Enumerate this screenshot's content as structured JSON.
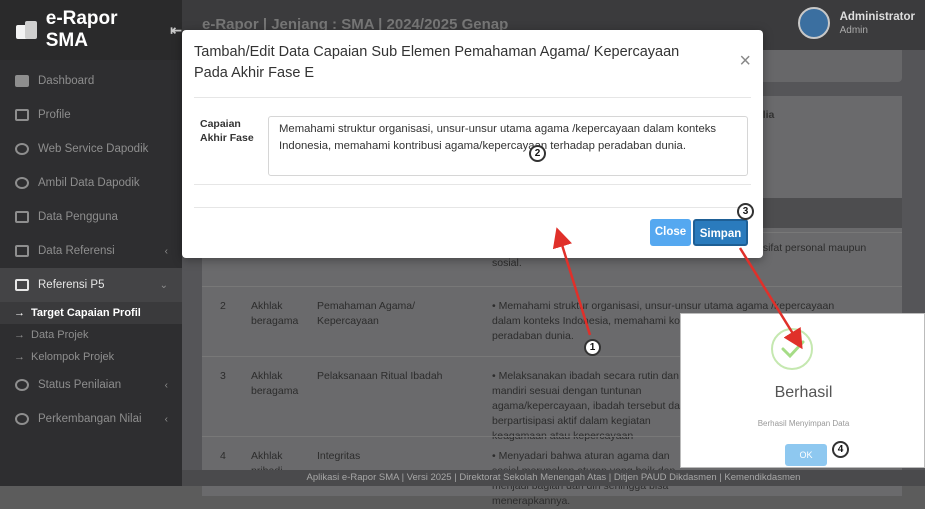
{
  "app": {
    "brand": "e-Rapor SMA",
    "collapse_icon": "collapse-left-icon"
  },
  "sidebar": {
    "items": [
      {
        "label": "Dashboard",
        "icon": "dashboard-icon"
      },
      {
        "label": "Profile",
        "icon": "profile-icon"
      },
      {
        "label": "Web Service Dapodik",
        "icon": "gear-icon"
      },
      {
        "label": "Ambil Data Dapodik",
        "icon": "database-icon"
      },
      {
        "label": "Data Pengguna",
        "icon": "users-icon"
      },
      {
        "label": "Data Referensi",
        "icon": "monitor-icon"
      },
      {
        "label": "Referensi P5",
        "icon": "list-icon"
      },
      {
        "label": "Target Capaian Profil",
        "icon": "arrow-icon"
      },
      {
        "label": "Data Projek",
        "icon": "arrow-icon"
      },
      {
        "label": "Kelompok Projek",
        "icon": "arrow-icon"
      },
      {
        "label": "Status Penilaian",
        "icon": "grad-cap-icon"
      },
      {
        "label": "Perkembangan Nilai",
        "icon": "grad-cap-icon"
      }
    ]
  },
  "topbar": {
    "title": "e-Rapor | Jenjang : SMA | 2024/2025 Genap",
    "user_name": "Administrator",
    "user_role": "Admin"
  },
  "content": {
    "tab_title": "erakhlak Mulia",
    "rows": [
      {
        "no": "2",
        "dimensi": "Akhlak beragama",
        "sub": "Pemahaman Agama/ Kepercayaan",
        "desc": "• Memahami struktur organisasi, unsur-unsur utama agama /kepercayaan dalam konteks Indonesia, memahami kontribusi agama/kepercayaan terhadap peradaban dunia."
      },
      {
        "no": "3",
        "dimensi": "Akhlak beragama",
        "sub": "Pelaksanaan Ritual Ibadah",
        "desc": "• Melaksanakan ibadah secara rutin dan mandiri sesuai dengan tuntunan agama/kepercayaan, ibadah tersebut dan berpartisipasi aktif dalam kegiatan keagamaan atau kepercayaan"
      },
      {
        "no": "4",
        "dimensi": "Akhlak pribadi",
        "sub": "Integritas",
        "desc": "• Menyadari bahwa aturan agama dan sosial merupakan aturan yang baik dan menjadi bagian dari diri sehingga bisa menerapkannya."
      }
    ],
    "row1_tail": "at-sifat Tuhan dalam ritual ibadahnya dan ibadah yang bersifat personal maupun sosial."
  },
  "footer": "Aplikasi e-Rapor SMA | Versi 2025 | Direktorat Sekolah Menengah Atas | Ditjen PAUD Dikdasmen | Kemendikdasmen",
  "modal": {
    "title": "Tambah/Edit Data Capaian Sub Elemen Pemahaman Agama/ Kepercayaan Pada Akhir Fase E",
    "field_label": "Capaian Akhir Fase",
    "field_value": "Memahami struktur organisasi, unsur-unsur utama agama /kepercayaan dalam konteks Indonesia, memahami kontribusi agama/kepercayaan terhadap peradaban dunia.",
    "close": "Close",
    "save": "Simpan"
  },
  "success": {
    "title": "Berhasil",
    "message": "Berhasil Menyimpan Data",
    "ok": "OK"
  },
  "badges": [
    "1",
    "2",
    "3",
    "4"
  ],
  "colors": {
    "accent": "#2a7bbd",
    "arrow": "#e0302a",
    "success": "#a5dc86"
  }
}
